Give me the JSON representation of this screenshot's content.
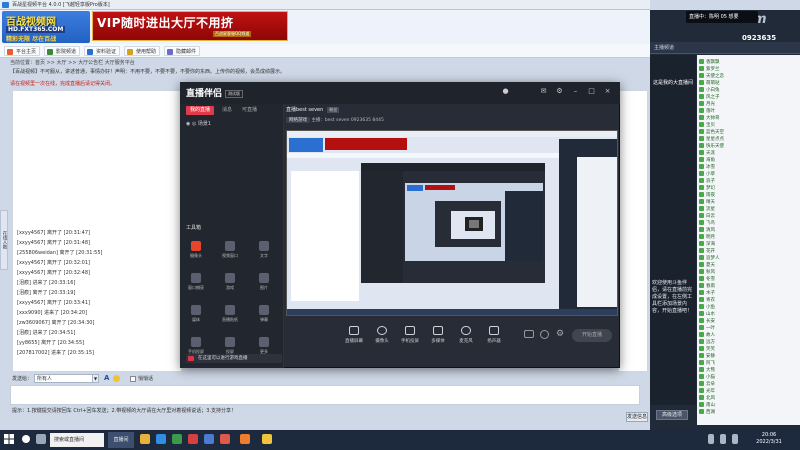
{
  "window": {
    "title": "百战星视频平台 4.0.0 [飞越轻享版Pro版本]"
  },
  "logo": {
    "line1": "百战视频网",
    "line2": "HD.FXT365.COM",
    "line3": "精彩无限 尽在百战"
  },
  "vip_banner": {
    "text": "VIP随时进出大厅不用挤",
    "sub": "百战星客服QQ频道"
  },
  "toolbar": {
    "items": [
      "平台主页",
      "影院频道",
      "资料验证",
      "使用帮助",
      "隐藏邮件"
    ]
  },
  "info": {
    "line1": "当前位置：首页 >> 大厅 >> 大厅公告栏 大厅服务平台",
    "line2": "【百战视频】不可服从，讲述普通，事情办好！声明：不用不要，不要不要，不要你的东西。上传你的视频，会员成绩展示。",
    "line3": "请在视频里一次在线，完成直播后请记得关闭。"
  },
  "chat": {
    "lines": [
      "[xxyy4567] 离开了 [20:31:47]",
      "[xxyy4567] 离开了 [20:31:48]",
      "[255806weidan] 离开了 [20:31:55]",
      "[xxyy4567] 离开了 [20:32:01]",
      "[xxyy4567] 离开了 [20:32:48]",
      "[泪痕] 进来了 [20:33:16]",
      "[泪痕] 离开了 [20:33:19]",
      "[xxyy4567] 离开了 [20:33:41]",
      "[xxx9090] 进来了 [20:34:20]",
      "[zw3609067] 离开了 [20:34:30]",
      "[泪痕] 进来了 [20:34:51]",
      "[yy8655] 离开了 [20:34:55]",
      "[207817002] 进来了 [20:35:15]"
    ]
  },
  "left_tab": "在线人数",
  "send": {
    "label": "发送给：",
    "target": "所有人",
    "checkbox_label": "悄悄话",
    "tips": "提示：1.按键提交请按回车 Ctrl+回车发送；2.带视频的大厅请在大厅里对着视频说话；3.支持分享！",
    "button": "发送信息"
  },
  "right_panel": {
    "header": "主播频道",
    "overlay_title": "直播中：陈明 05 想要",
    "overlay_number": "0923635",
    "watermark": "shm",
    "video_title": "这是我的大直播间",
    "video_text": "欢迎使用斗鱼伴侣，请在直播前完成设置，在左侧工具栏添加场景内容，开始直播吧！",
    "bottom_button": "高级选项",
    "members": [
      "香飘飘",
      "紫罗兰",
      "天使之恋",
      "萌萌哒",
      "小白兔",
      "风之子",
      "月光",
      "落叶",
      "大帅哥",
      "宝贝",
      "蓝色天空",
      "星星点点",
      "快乐天使",
      "天涯",
      "海角",
      "冰雪",
      "小草",
      "浪子",
      "梦幻",
      "雨夜",
      "晴天",
      "流星",
      "白云",
      "飞鸟",
      "清风",
      "明月",
      "深海",
      "花开",
      "追梦人",
      "夏天",
      "秋风",
      "冬雪",
      "春雨",
      "木子",
      "青衣",
      "小鱼",
      "山水",
      "长安",
      "一叶",
      "故人",
      "远方",
      "笑笑",
      "安静",
      "阿飞",
      "大熊",
      "小猫",
      "云朵",
      "光年",
      "北风",
      "南山",
      "西湖"
    ]
  },
  "stream_app": {
    "logo": "直播伴侣",
    "version": "测试版",
    "tabs": [
      "我的直播",
      "消息",
      "可直播"
    ],
    "scene": "场景1",
    "tools_label": "工具箱",
    "tools": [
      "摄像头",
      "视频窗口",
      "文字",
      "窗口捕获",
      "游戏",
      "图片",
      "媒体",
      "直播贴纸",
      "弹幕",
      "手机投屏",
      "投屏",
      "更多"
    ],
    "title": "直播best seven",
    "title_tag": "粉丝",
    "sub_tag": "网络游戏",
    "sub_text": "主播：best seven 0923635",
    "sub_viewers": "8445",
    "controls": [
      "直播屏幕",
      "摄像头",
      "手机投屏",
      "多媒体",
      "麦克风",
      "扬声器"
    ],
    "go_live": "开始直播",
    "bottom_ad": "在这里可以进行游戏直播"
  },
  "taskbar": {
    "search": "搜索或直播间",
    "active_app": "直播间",
    "time": "20:06",
    "date": "2022/3/31"
  },
  "colors": {
    "accent_red": "#e23a4a",
    "banner_red": "#c01212",
    "panel_dark": "#202a38",
    "online_green": "#1a5f1a"
  }
}
